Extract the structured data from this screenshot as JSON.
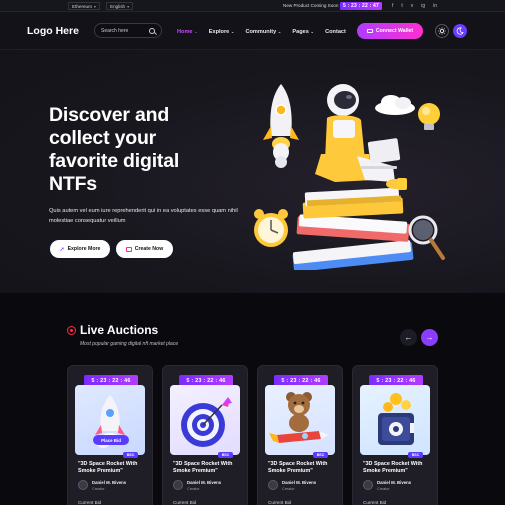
{
  "topbar": {
    "network": "Ethereum",
    "language": "English",
    "promo": "New Product Coming Soon",
    "timer": "5 : 23 : 22 : 47",
    "socials": [
      "f",
      "t",
      "v",
      "ig",
      "in"
    ]
  },
  "header": {
    "logo": "Logo Here",
    "search_placeholder": "Search here",
    "nav": [
      {
        "label": "Home",
        "active": true
      },
      {
        "label": "Explore"
      },
      {
        "label": "Community"
      },
      {
        "label": "Pages"
      },
      {
        "label": "Contact"
      }
    ],
    "connect_label": "Connect Wallet"
  },
  "hero": {
    "title": "Discover and collect your favorite digital NTFs",
    "subtitle": "Quis autem vel eum iure reprehenderit qui in ea voluptates esse quam nihil molestiae consequatur veillum",
    "explore_label": "Explore More",
    "create_label": "Create Now"
  },
  "auctions": {
    "title": "Live Auctions",
    "subtitle": "Most popular gaming digital nft market place",
    "cards": [
      {
        "timer": "5 : 23 : 22 : 46",
        "chain": "BSC",
        "title": "\"3D Space Rocket With Smoke Premium\"",
        "author": "Daniel M. Bivens",
        "role": "Creator",
        "bid_label": "Current Bid",
        "place_bid": "Place Bid"
      },
      {
        "timer": "5 : 23 : 22 : 46",
        "chain": "BSC",
        "title": "\"3D Space Rocket With Smoke Premium\"",
        "author": "Daniel M. Bivens",
        "role": "Creator",
        "bid_label": "Current Bid"
      },
      {
        "timer": "5 : 23 : 22 : 46",
        "chain": "BSC",
        "title": "\"3D Space Rocket With Smoke Premium\"",
        "author": "Daniel M. Bivens",
        "role": "Creator",
        "bid_label": "Current Bid"
      },
      {
        "timer": "5 : 23 : 22 : 46",
        "chain": "BSC",
        "title": "\"3D Space Rocket With Smoke Premium\"",
        "author": "Daniel M. Bivens",
        "role": "Creator",
        "bid_label": "Current Bid"
      }
    ]
  },
  "colors": {
    "accent_purple": "#b03cff",
    "accent_pink": "#ff2fd0",
    "live_red": "#ff2b4a",
    "chain_badge": "#5b3cff"
  }
}
